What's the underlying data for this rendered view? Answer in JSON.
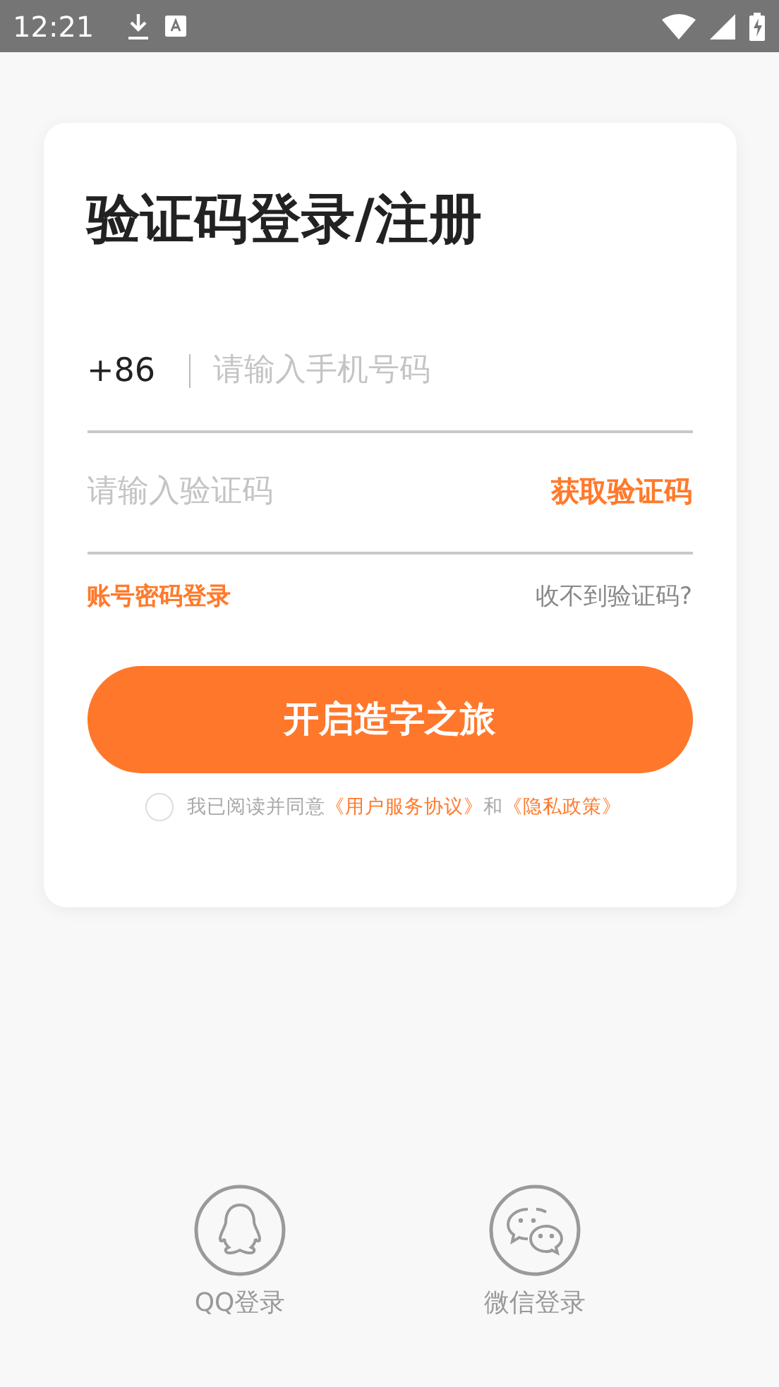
{
  "status_bar": {
    "time": "12:21"
  },
  "title": "验证码登录/注册",
  "phone": {
    "prefix": "+86",
    "placeholder": "请输入手机号码"
  },
  "code": {
    "placeholder": "请输入验证码",
    "action": "获取验证码"
  },
  "links": {
    "password_login": "账号密码登录",
    "no_code": "收不到验证码?"
  },
  "submit": "开启造字之旅",
  "agreement": {
    "checked": false,
    "text": "我已阅读并同意",
    "terms": "《用户服务协议》",
    "and": "和",
    "privacy": "《隐私政策》"
  },
  "social": [
    {
      "kind": "qq",
      "label": "QQ登录"
    },
    {
      "kind": "wechat",
      "label": "微信登录"
    }
  ]
}
